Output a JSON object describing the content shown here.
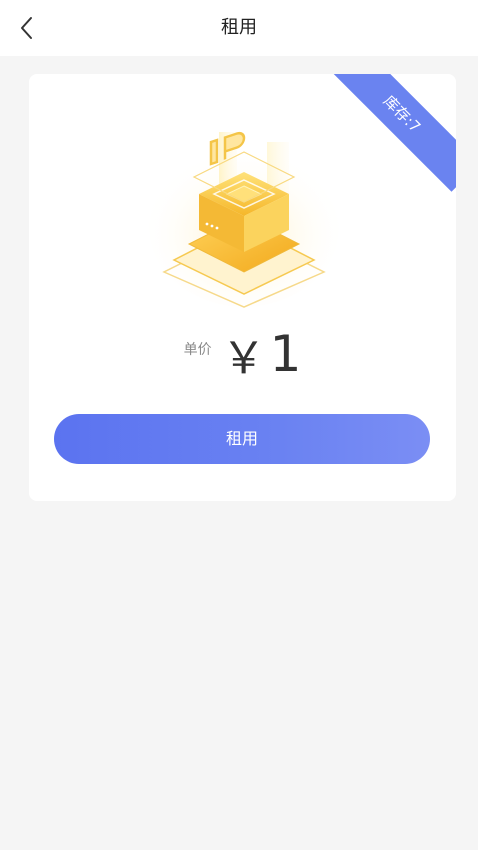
{
  "nav": {
    "title": "租用"
  },
  "card": {
    "ribbon_text": "库存:7",
    "price_label": "单价",
    "currency_symbol": "￥",
    "price_value": "1",
    "rent_button_label": "租用",
    "illustration": "ip-chip-icon"
  },
  "colors": {
    "accent": "#6a83f0",
    "background": "#f5f5f5",
    "gold": "#f5c542"
  }
}
